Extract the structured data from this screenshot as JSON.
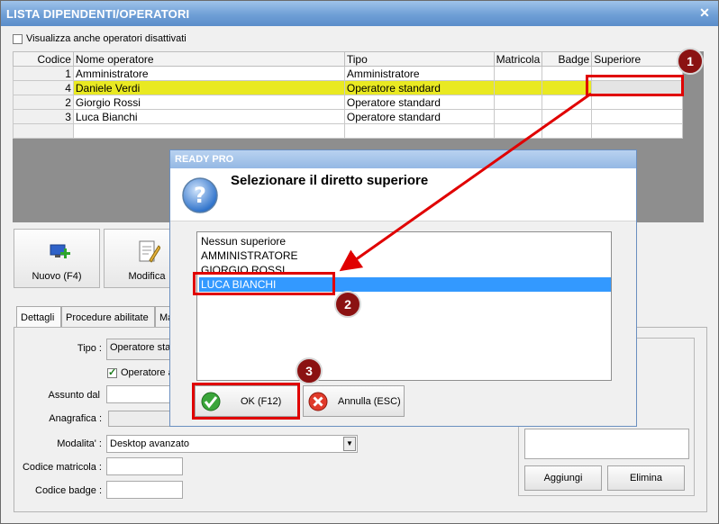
{
  "window": {
    "title": "LISTA DIPENDENTI/OPERATORI"
  },
  "filter": {
    "show_disabled_label": "Visualizza anche operatori disattivati"
  },
  "grid": {
    "headers": [
      "Codice",
      "Nome operatore",
      "Tipo",
      "Matricola",
      "Badge",
      "Superiore"
    ],
    "rows": [
      {
        "codice": "1",
        "nome": "Amministratore",
        "tipo": "Amministratore"
      },
      {
        "codice": "4",
        "nome": "Daniele Verdi",
        "tipo": "Operatore standard"
      },
      {
        "codice": "2",
        "nome": "Giorgio Rossi",
        "tipo": "Operatore standard"
      },
      {
        "codice": "3",
        "nome": "Luca Bianchi",
        "tipo": "Operatore standard"
      }
    ]
  },
  "toolbar": {
    "new_label": "Nuovo (F4)",
    "edit_label": "Modifica"
  },
  "tabs": [
    "Dettagli",
    "Procedure abilitate",
    "Ma"
  ],
  "form": {
    "tipo_label": "Tipo :",
    "tipo_value": "Operatore sta",
    "operatore_checkbox_label": "Operatore a",
    "assunto_label": "Assunto dal",
    "anagrafica_label": "Anagrafica :",
    "modalita_label": "Modalita' :",
    "modalita_value": "Desktop avanzato",
    "matricola_label": "Codice matricola :",
    "badge_label": "Codice badge :"
  },
  "right_panel": {
    "add_label": "Aggiungi",
    "delete_label": "Elimina"
  },
  "dialog": {
    "title": "READY PRO",
    "heading": "Selezionare il diretto superiore",
    "options": [
      "Nessun superiore",
      "AMMINISTRATORE",
      "GIORGIO ROSSI",
      "LUCA BIANCHI"
    ],
    "selected": "LUCA BIANCHI",
    "ok_label": "OK (F12)",
    "cancel_label": "Annulla (ESC)"
  },
  "annotations": [
    "1",
    "2",
    "3"
  ],
  "colors": {
    "selected_row": "#e9e922",
    "selection_blue": "#3399ff",
    "annotation_red": "#e00000"
  }
}
